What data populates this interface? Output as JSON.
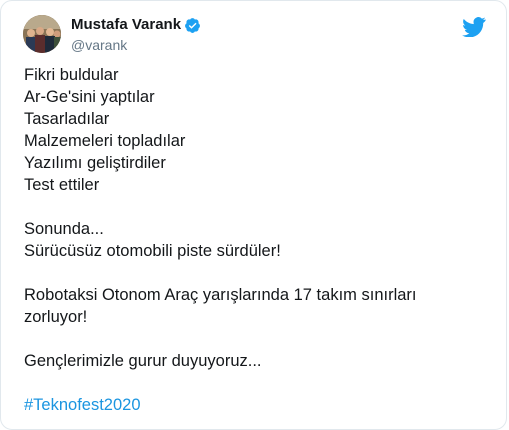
{
  "author": {
    "display_name": "Mustafa Varank",
    "handle": "@varank",
    "verified_icon": "verified-badge-icon",
    "verified_color": "#1da1f2"
  },
  "brand": {
    "icon": "twitter-bird-icon",
    "color": "#1da1f2"
  },
  "tweet": {
    "lines": [
      "Fikri buldular",
      "Ar-Ge'sini yaptılar",
      "Tasarladılar",
      "Malzemeleri topladılar",
      "Yazılımı geliştirdiler",
      "Test ettiler",
      "Sonunda...",
      "Sürücüsüz otomobili piste sürdüler!",
      "Robotaksi Otonom Araç yarışlarında 17 takım sınırları",
      "zorluyor!",
      "Gençlerimizle gurur duyuyoruz..."
    ],
    "hashtag": "#Teknofest2020",
    "hashtag_color": "#1b95e0"
  }
}
